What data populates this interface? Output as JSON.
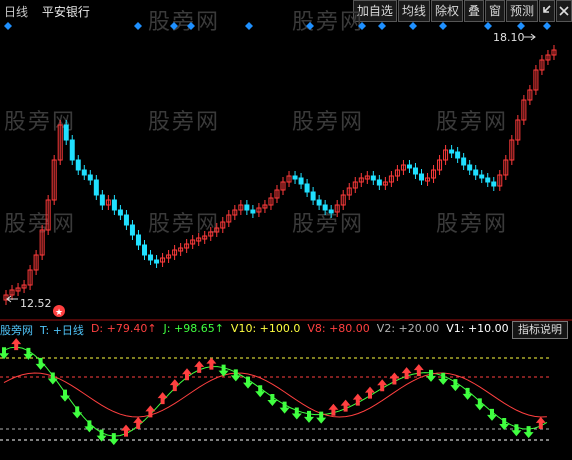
{
  "header": {
    "period": "日线",
    "stock_name": "平安银行",
    "tools": [
      {
        "label": "加自选",
        "icon": ""
      },
      {
        "label": "均线",
        "icon": ""
      },
      {
        "label": "除权",
        "icon": ""
      },
      {
        "label": "叠",
        "icon": ""
      },
      {
        "label": "窗",
        "icon": ""
      },
      {
        "label": "预测",
        "icon": ""
      },
      {
        "label": "",
        "icon": "arrow-left-down-icon"
      },
      {
        "label": "",
        "icon": "close-icon"
      }
    ]
  },
  "watermark": "股旁网",
  "price_chart": {
    "high_label": "18.10",
    "low_label": "12.52",
    "colors": {
      "up": "#ff3b3b",
      "down": "#20e0ff",
      "background": "#000000",
      "event_marker": "#1e90ff"
    }
  },
  "indicator": {
    "name": "股旁网",
    "items": [
      {
        "label": "T: +日线",
        "color": "#4fc3f7"
      },
      {
        "label": "D: +79.40↑",
        "color": "#ff4040"
      },
      {
        "label": "J: +98.65↑",
        "color": "#40ff40"
      },
      {
        "label": "V10: +100.0",
        "color": "#ffff40"
      },
      {
        "label": "V8: +80.00",
        "color": "#ff4040"
      },
      {
        "label": "V2: +20.00",
        "color": "#b0b0b0"
      },
      {
        "label": "V1: +10.00",
        "color": "#ffffff"
      }
    ],
    "help_button": "指标说明"
  }
}
